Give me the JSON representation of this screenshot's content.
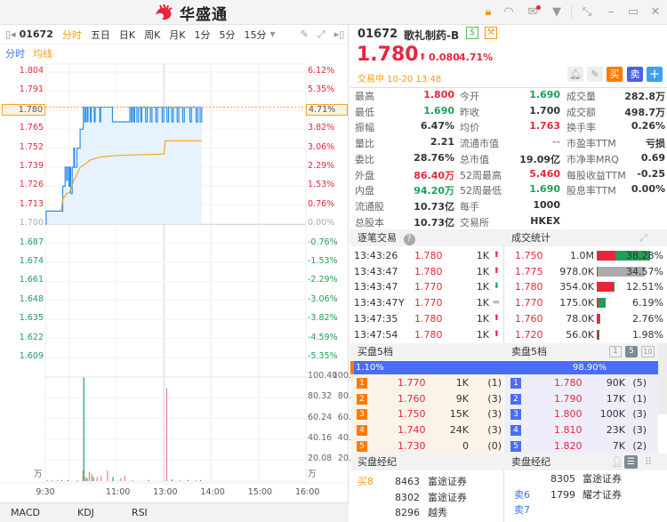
{
  "app": {
    "logo_text": "华盛通"
  },
  "toolbar": {
    "code": "01672",
    "tabs": [
      "分时",
      "五日",
      "日K",
      "周K",
      "月K",
      "1分",
      "5分",
      "15分"
    ],
    "active_tab": "分时"
  },
  "legend": {
    "price": "分时",
    "avg": "均线"
  },
  "chart_data": {
    "type": "line",
    "title": "01672 分时",
    "price_axis_left": [
      "1.804",
      "1.791",
      "1.780",
      "1.765",
      "1.752",
      "1.739",
      "1.726",
      "1.713",
      "1.700",
      "1.687",
      "1.674",
      "1.661",
      "1.648",
      "1.635",
      "1.622",
      "1.609"
    ],
    "price_axis_right": [
      "6.12%",
      "5.35%",
      "4.71%",
      "3.82%",
      "3.06%",
      "2.29%",
      "1.53%",
      "0.76%",
      "0.00%",
      "-0.76%",
      "-1.53%",
      "-2.29%",
      "-3.06%",
      "-3.82%",
      "-4.59%",
      "-5.35%"
    ],
    "ylim": [
      1.6045,
      1.8075
    ],
    "prev_close": 1.7,
    "current_price_label": "1.780",
    "current_pct_label": "4.71%",
    "volume_axis": [
      "100.40",
      "80.32",
      "60.24",
      "40.16",
      "20.08"
    ],
    "volume_unit": "万",
    "time_ticks": [
      "9:30",
      "11:00",
      "13:00",
      "14:00",
      "15:00",
      "16:00"
    ],
    "x_unit": "trading minutes since 9:30 (lunch excluded)",
    "price_series": [
      [
        0,
        1.7
      ],
      [
        1,
        1.709
      ],
      [
        21,
        1.709
      ],
      [
        22,
        1.726
      ],
      [
        24,
        1.726
      ],
      [
        25,
        1.739
      ],
      [
        27,
        1.73
      ],
      [
        28,
        1.739
      ],
      [
        30,
        1.726
      ],
      [
        31,
        1.739
      ],
      [
        32,
        1.721
      ],
      [
        34,
        1.739
      ],
      [
        36,
        1.752
      ],
      [
        37,
        1.739
      ],
      [
        38,
        1.739
      ],
      [
        40,
        1.752
      ],
      [
        43,
        1.752
      ],
      [
        44,
        1.765
      ],
      [
        47,
        1.765
      ],
      [
        48,
        1.78
      ],
      [
        50,
        1.77
      ],
      [
        51,
        1.78
      ],
      [
        53,
        1.77
      ],
      [
        54,
        1.78
      ],
      [
        57,
        1.77
      ],
      [
        58,
        1.78
      ],
      [
        62,
        1.77
      ],
      [
        63,
        1.78
      ],
      [
        68,
        1.78
      ],
      [
        69,
        1.77
      ],
      [
        70,
        1.78
      ],
      [
        84,
        1.78
      ],
      [
        85,
        1.77
      ],
      [
        106,
        1.77
      ],
      [
        107,
        1.78
      ],
      [
        109,
        1.77
      ],
      [
        110,
        1.78
      ],
      [
        112,
        1.77
      ],
      [
        113,
        1.78
      ],
      [
        116,
        1.77
      ],
      [
        118,
        1.78
      ],
      [
        121,
        1.77
      ],
      [
        122,
        1.78
      ],
      [
        127,
        1.77
      ],
      [
        129,
        1.78
      ],
      [
        133,
        1.77
      ],
      [
        135,
        1.78
      ],
      [
        140,
        1.77
      ],
      [
        142,
        1.78
      ],
      [
        148,
        1.77
      ],
      [
        150,
        1.78
      ],
      [
        154,
        1.77
      ],
      [
        156,
        1.78
      ],
      [
        160,
        1.77
      ],
      [
        162,
        1.78
      ],
      [
        167,
        1.77
      ],
      [
        169,
        1.78
      ],
      [
        174,
        1.77
      ],
      [
        176,
        1.78
      ],
      [
        183,
        1.77
      ],
      [
        185,
        1.78
      ],
      [
        191,
        1.77
      ],
      [
        193,
        1.78
      ],
      [
        196,
        1.77
      ],
      [
        198,
        1.78
      ]
    ],
    "avg_series": [
      [
        20,
        1.709
      ],
      [
        22,
        1.717
      ],
      [
        27,
        1.721
      ],
      [
        31,
        1.722
      ],
      [
        36,
        1.73
      ],
      [
        40,
        1.734
      ],
      [
        44,
        1.739
      ],
      [
        50,
        1.741
      ],
      [
        57,
        1.744
      ],
      [
        70,
        1.746
      ],
      [
        90,
        1.747
      ],
      [
        150,
        1.748
      ],
      [
        152,
        1.757
      ],
      [
        198,
        1.757
      ]
    ],
    "volume_series": [
      [
        2,
        1,
        "up"
      ],
      [
        8,
        1,
        "up"
      ],
      [
        15,
        1.2,
        "up"
      ],
      [
        20,
        0.8,
        "down"
      ],
      [
        28,
        1,
        "down"
      ],
      [
        40,
        1,
        "up"
      ],
      [
        47,
        10,
        "up"
      ],
      [
        48,
        100,
        "down"
      ],
      [
        50,
        4,
        "up"
      ],
      [
        52,
        3,
        "down"
      ],
      [
        55,
        9,
        "up"
      ],
      [
        58,
        7,
        "up"
      ],
      [
        60,
        4,
        "down"
      ],
      [
        65,
        4,
        "up"
      ],
      [
        70,
        5,
        "up"
      ],
      [
        78,
        10,
        "up"
      ],
      [
        85,
        4,
        "down"
      ],
      [
        95,
        3,
        "up"
      ],
      [
        100,
        5,
        "up"
      ],
      [
        110,
        1,
        "up"
      ],
      [
        130,
        1,
        "down"
      ],
      [
        153,
        90,
        "up"
      ],
      [
        160,
        1.5,
        "down"
      ],
      [
        170,
        1,
        "up"
      ],
      [
        180,
        1,
        "down"
      ],
      [
        190,
        1,
        "up"
      ],
      [
        196,
        1,
        "down"
      ]
    ]
  },
  "indicators": [
    "MACD",
    "KDJ",
    "RSI"
  ],
  "quote": {
    "code": "01672",
    "name": "歌礼制药-B",
    "price": "1.780",
    "change": "0.080",
    "change_pct": "4.71%",
    "status": "交易中 10-20 13:48",
    "buy_label": "买",
    "sell_label": "卖",
    "add_label": "+",
    "stats": [
      [
        [
          "最高",
          "1.800",
          "red"
        ],
        [
          "今开",
          "1.690",
          "green"
        ],
        [
          "成交量",
          "282.8万",
          ""
        ]
      ],
      [
        [
          "最低",
          "1.690",
          "green"
        ],
        [
          "昨收",
          "1.700",
          ""
        ],
        [
          "成交额",
          "498.7万",
          ""
        ]
      ],
      [
        [
          "振幅",
          "6.47%",
          ""
        ],
        [
          "均价",
          "1.763",
          "red"
        ],
        [
          "换手率",
          "0.26%",
          ""
        ]
      ],
      [
        [
          "量比",
          "2.21",
          ""
        ],
        [
          "流通市值",
          "--",
          "gray"
        ],
        [
          "市盈率TTM",
          "亏损",
          ""
        ]
      ],
      [
        [
          "委比",
          "28.76%",
          ""
        ],
        [
          "总市值",
          "19.09亿",
          ""
        ],
        [
          "市净率MRQ",
          "0.69",
          ""
        ]
      ],
      [
        [
          "外盘",
          "86.40万",
          "red"
        ],
        [
          "52周最高",
          "5.460",
          "red"
        ],
        [
          "每股收益TTM",
          "-0.25",
          ""
        ]
      ],
      [
        [
          "内盘",
          "94.20万",
          "green"
        ],
        [
          "52周最低",
          "1.690",
          "green"
        ],
        [
          "股息率TTM",
          "0.00%",
          ""
        ]
      ],
      [
        [
          "流通股",
          "10.73亿",
          ""
        ],
        [
          "每手",
          "1000",
          ""
        ],
        [
          "",
          "",
          " "
        ]
      ],
      [
        [
          "总股本",
          "10.73亿",
          ""
        ],
        [
          "交易所",
          "HKEX",
          ""
        ],
        [
          "",
          "",
          " "
        ]
      ]
    ]
  },
  "ticks": {
    "title": "逐笔交易",
    "rows": [
      [
        "13:43:26",
        "",
        "1.780",
        "1K",
        "up"
      ],
      [
        "13:43:47",
        "",
        "1.780",
        "1K",
        "up"
      ],
      [
        "13:43:47",
        "",
        "1.770",
        "1K",
        "down"
      ],
      [
        "13:43:47",
        "Y",
        "1.770",
        "1K",
        "flat"
      ],
      [
        "13:47:35",
        "",
        "1.780",
        "1K",
        "up"
      ],
      [
        "13:47:54",
        "",
        "1.780",
        "1K",
        "up"
      ]
    ]
  },
  "stats_vol": {
    "title": "成交统计",
    "rows": [
      [
        "1.750",
        "1.0M",
        "38.28%",
        38.28,
        0.35
      ],
      [
        "1.775",
        "978.0K",
        "34.57%",
        34.57,
        0.02
      ],
      [
        "1.780",
        "354.0K",
        "12.51%",
        12.51,
        0.95
      ],
      [
        "1.770",
        "175.0K",
        "6.19%",
        6.19,
        0.2
      ],
      [
        "1.760",
        "78.0K",
        "2.76%",
        2.76,
        0.8
      ],
      [
        "1.720",
        "56.0K",
        "1.98%",
        1.98,
        0.5
      ]
    ]
  },
  "book": {
    "bid_title": "买盘5档",
    "ask_title": "卖盘5档",
    "depth_options": [
      "1",
      "5",
      "10"
    ],
    "bid_pct": "1.10%",
    "ask_pct": "98.90%",
    "bid_ratio": 1.1,
    "bids": [
      [
        "1",
        "1.770",
        "1K",
        "(1)"
      ],
      [
        "2",
        "1.760",
        "9K",
        "(3)"
      ],
      [
        "3",
        "1.750",
        "15K",
        "(3)"
      ],
      [
        "4",
        "1.740",
        "24K",
        "(3)"
      ],
      [
        "5",
        "1.730",
        "0",
        "(0)"
      ]
    ],
    "asks": [
      [
        "1",
        "1.780",
        "90K",
        "(5)"
      ],
      [
        "2",
        "1.790",
        "17K",
        "(1)"
      ],
      [
        "3",
        "1.800",
        "100K",
        "(3)"
      ],
      [
        "4",
        "1.810",
        "23K",
        "(3)"
      ],
      [
        "5",
        "1.820",
        "7K",
        "(2)"
      ]
    ]
  },
  "brokers": {
    "bid_title": "买盘经纪",
    "ask_title": "卖盘经纪",
    "bid_rows": [
      [
        "买8",
        "8463",
        "富途证券"
      ],
      [
        "",
        "8302",
        "富途证券"
      ],
      [
        "",
        "8296",
        "越秀"
      ]
    ],
    "ask_rows": [
      [
        "",
        "8305",
        "富途证券"
      ],
      [
        "卖6",
        "1799",
        "耀才证券"
      ],
      [
        "卖7",
        "",
        ""
      ]
    ]
  },
  "colors": {
    "up": "#e8263a",
    "down": "#1ea05a",
    "accent": "#f39c12",
    "blue": "#3b73f0",
    "line": "#2f8fe6"
  }
}
